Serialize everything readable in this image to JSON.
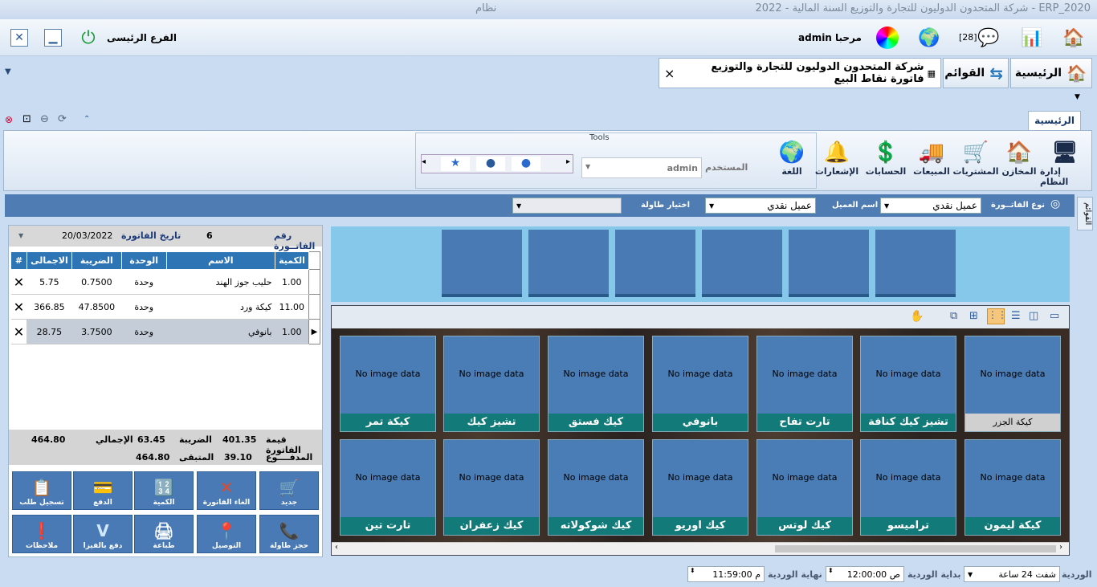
{
  "title_bar": {
    "title": "ERP_2020 - شركة المتحدون الدوليون للتجارة والتوزيع السنة المالية - 2022",
    "system": "نظام"
  },
  "top_bar": {
    "branch": "الفرع الرئيسى",
    "welcome": "مرحبا",
    "user": "admin",
    "messages_count": "[28]"
  },
  "tabs": {
    "home": "الرئيسية",
    "lists": "القوائم",
    "invoice": "شركة المتحدون الدوليون للتجارة والتوزيع فاتورة نقاط البيع",
    "close": "×"
  },
  "ribbon": {
    "active_tab": "الرئيسية",
    "group_label": "Tools",
    "buttons": [
      "إدارة النظام",
      "المخازن",
      "المشتريات",
      "المبيعات",
      "الحسابات",
      "الإشعارات",
      "اللغة"
    ],
    "user_label": "المستخدم",
    "user_value": "admin"
  },
  "filter_bar": {
    "invoice_type_label": "نوع الفاتــورة",
    "invoice_type_value": "عميل نقدي",
    "customer_label": "اسم العميل",
    "customer_value": "عميل نقدي",
    "table_label": "اختيار طاولة",
    "table_value": ""
  },
  "side_tab": "القوائم",
  "invoice": {
    "number_label": "رقم الفاتــورة",
    "number": "6",
    "date_label": "تاريخ الفاتورة",
    "date": "20/03/2022",
    "columns": [
      "الكمية",
      "الاسم",
      "الوحدة",
      "الضريبة",
      "الاجمالى",
      "#"
    ],
    "rows": [
      {
        "qty": "1.00",
        "name": "حليب جوز الهند",
        "unit": "وحدة",
        "tax": "0.7500",
        "total": "5.75"
      },
      {
        "qty": "11.00",
        "name": "كيكة ورد",
        "unit": "وحدة",
        "tax": "47.8500",
        "total": "366.85"
      },
      {
        "qty": "1.00",
        "name": "بانوفي",
        "unit": "وحدة",
        "tax": "3.7500",
        "total": "28.75"
      }
    ],
    "totals": {
      "invoice_value_label": "قيمة الفاتورة",
      "invoice_value": "401.35",
      "tax_label": "الضريبة",
      "tax": "63.45",
      "grand_label": "الإجمالي",
      "grand": "464.80",
      "paid_label": "المدفــــوع",
      "paid": "39.10",
      "remaining_label": "المتبقى",
      "remaining": "464.80"
    }
  },
  "actions": [
    {
      "label": "جديد",
      "icon": "cart-icon"
    },
    {
      "label": "الغاء الفاتورة",
      "icon": "x-icon"
    },
    {
      "label": "الكمية",
      "icon": "numbers-icon"
    },
    {
      "label": "الدفع",
      "icon": "card-icon"
    },
    {
      "label": "تسجيل طلب",
      "icon": "order-icon"
    },
    {
      "label": "حجز طاولة",
      "icon": "phone-icon"
    },
    {
      "label": "التوصيل",
      "icon": "map-icon"
    },
    {
      "label": "طباعة",
      "icon": "printer-icon"
    },
    {
      "label": "دفع بالفيزا",
      "icon": "visa-icon"
    },
    {
      "label": "ملاحظات",
      "icon": "note-icon"
    }
  ],
  "no_image": "No image data",
  "products_row1": [
    "كيكة الجزر",
    "تشيز كيك كنافة",
    "تارت تفاح",
    "بانوفي",
    "كيك فستق",
    "تشيز كيك",
    "كيكة تمر"
  ],
  "products_row2": [
    "كيكة ليمون",
    "تراميسو",
    "كيك لوتس",
    "كيك اوريو",
    "كيك شوكولاته",
    "كيك زعفران",
    "تارت تين"
  ],
  "status_bar": {
    "shift_label": "الوردية",
    "shift_value": "شفت 24 ساعة",
    "start_label": "بداية الوردية",
    "start_value": "12:00:00 ص",
    "end_label": "نهاية الوردية",
    "end_value": "11:59:00 م"
  },
  "colors": {
    "accent": "#2e75b6",
    "tile": "#4a7cb6",
    "tile_label": "#137a7a"
  }
}
